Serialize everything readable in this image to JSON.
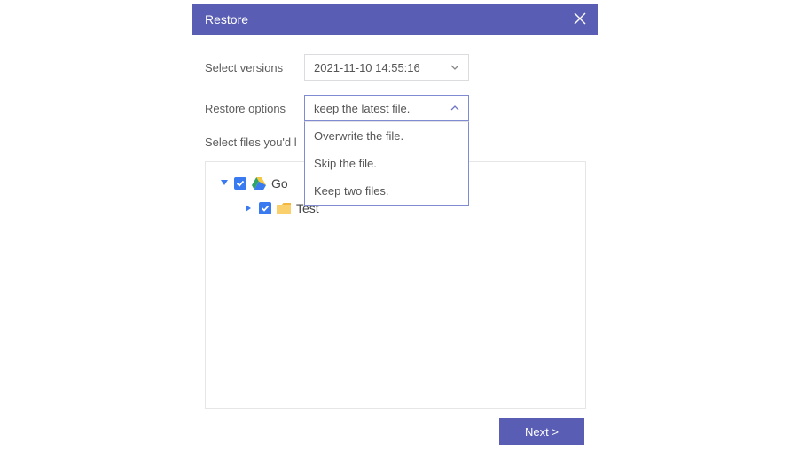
{
  "header": {
    "title": "Restore"
  },
  "fields": {
    "versions": {
      "label": "Select versions",
      "selected": "2021-11-10 14:55:16"
    },
    "restoreOptions": {
      "label": "Restore options",
      "selected": "keep the latest file.",
      "options": [
        "Overwrite the file.",
        "Skip the file.",
        "Keep two files."
      ]
    },
    "filesLabel": "Select files you'd l"
  },
  "tree": {
    "root": {
      "label": "Go"
    },
    "child": {
      "label": "Test"
    }
  },
  "footer": {
    "nextLabel": "Next >"
  }
}
